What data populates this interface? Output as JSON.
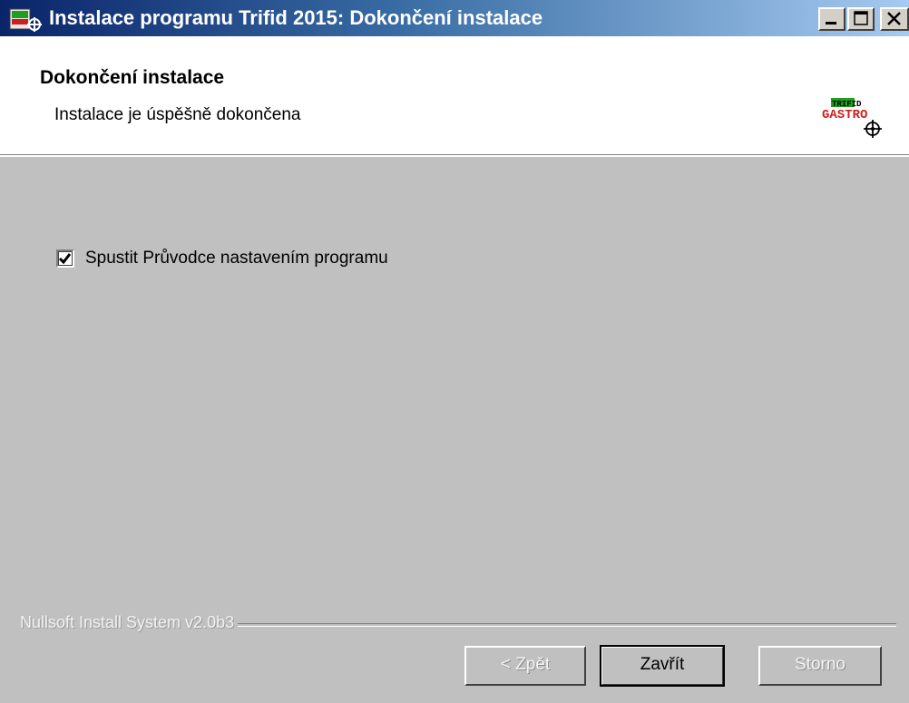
{
  "window": {
    "title": "Instalace programu Trifid 2015: Dokončení instalace"
  },
  "header": {
    "title": "Dokončení instalace",
    "subtitle": "Instalace je úspěšně dokončena",
    "logo": {
      "top_text": "TRIFID",
      "bottom_text": "GASTRO",
      "icon": "crosshair-icon"
    }
  },
  "options": {
    "run_wizard": {
      "label": "Spustit Průvodce nastavením programu",
      "checked": true
    }
  },
  "footer": {
    "branding": "Nullsoft Install System v2.0b3",
    "buttons": {
      "back": "< Zpět",
      "close": "Zavřít",
      "cancel": "Storno"
    }
  },
  "colors": {
    "titlebar_start": "#0a246a",
    "titlebar_end": "#a6caf0",
    "face": "#c0c0c0",
    "logo_green": "#1f9e1f",
    "logo_red": "#cc2020"
  }
}
